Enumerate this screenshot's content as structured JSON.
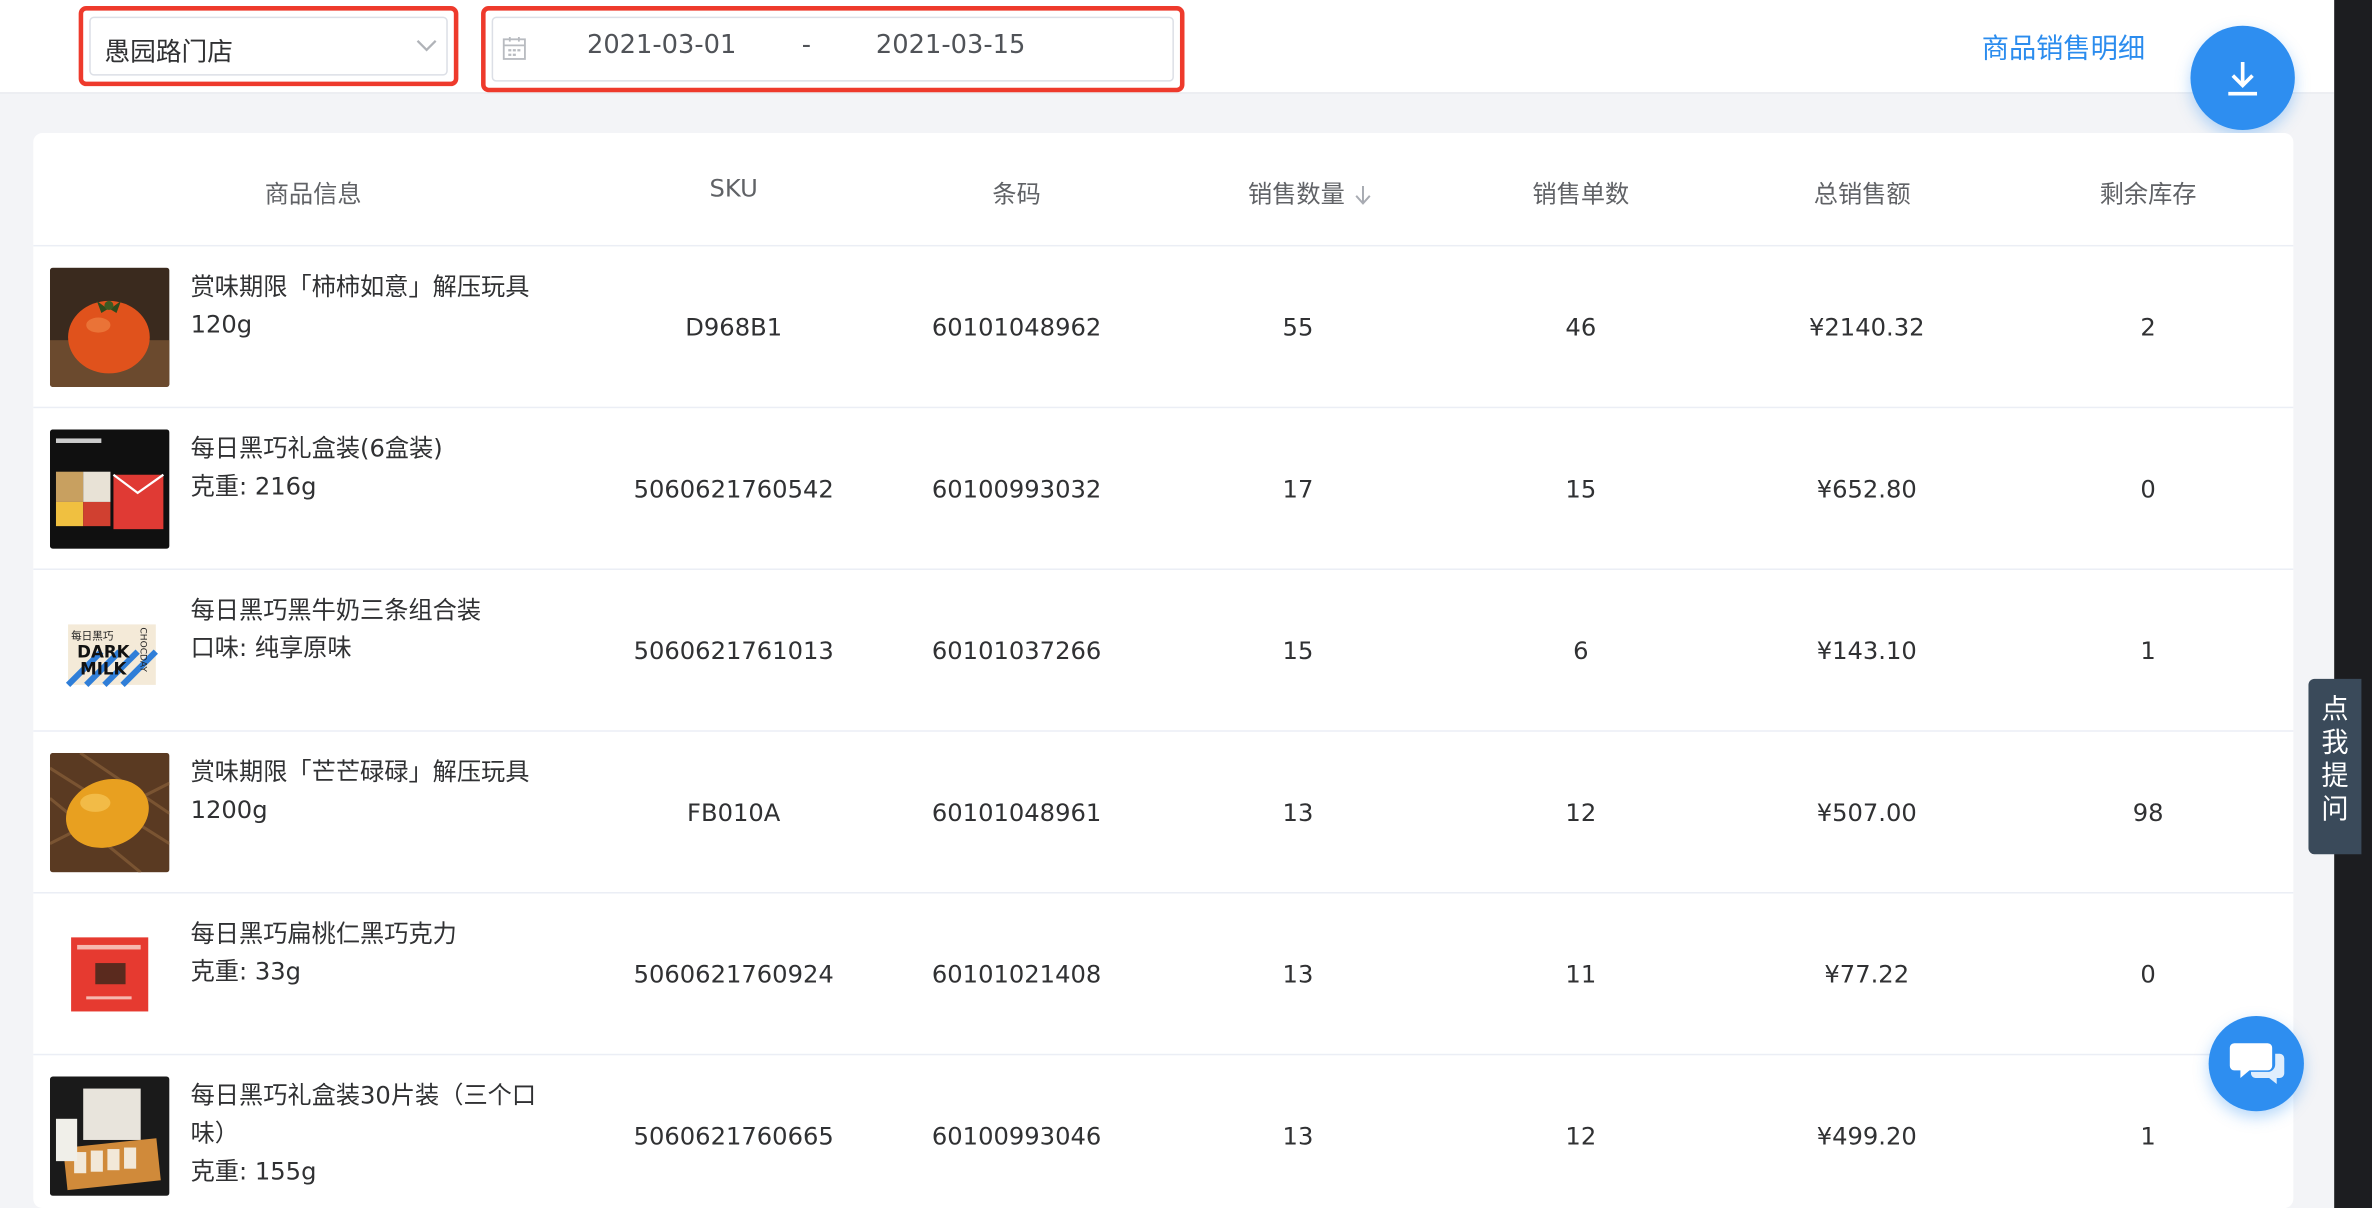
{
  "toolbar": {
    "store": "愚园路门店",
    "date_start": "2021-03-01",
    "date_sep": "-",
    "date_end": "2021-03-15",
    "detail_link": "商品销售明细"
  },
  "table": {
    "headers": {
      "product": "商品信息",
      "sku": "SKU",
      "barcode": "条码",
      "qty": "销售数量",
      "orders": "销售单数",
      "total": "总销售额",
      "stock": "剩余库存"
    },
    "sort": {
      "column": "qty",
      "direction": "desc"
    },
    "rows": [
      {
        "name": "赏味期限「柿柿如意」解压玩具",
        "spec": "120g",
        "sku": "D968B1",
        "barcode": "60101048962",
        "qty": "55",
        "orders": "46",
        "total": "¥2140.32",
        "stock": "2",
        "thumb": "persimmon"
      },
      {
        "name": "每日黑巧礼盒装(6盒装)",
        "spec": "克重: 216g",
        "sku": "5060621760542",
        "barcode": "60100993032",
        "qty": "17",
        "orders": "15",
        "total": "¥652.80",
        "stock": "0",
        "thumb": "giftbox"
      },
      {
        "name": "每日黑巧黑牛奶三条组合装",
        "spec": "口味: 纯享原味",
        "sku": "5060621761013",
        "barcode": "60101037266",
        "qty": "15",
        "orders": "6",
        "total": "¥143.10",
        "stock": "1",
        "thumb": "darkmilk"
      },
      {
        "name": "赏味期限「芒芒碌碌」解压玩具",
        "spec": "1200g",
        "sku": "FB010A",
        "barcode": "60101048961",
        "qty": "13",
        "orders": "12",
        "total": "¥507.00",
        "stock": "98",
        "thumb": "mango"
      },
      {
        "name": "每日黑巧扁桃仁黑巧克力",
        "spec": "克重: 33g",
        "sku": "5060621760924",
        "barcode": "60101021408",
        "qty": "13",
        "orders": "11",
        "total": "¥77.22",
        "stock": "0",
        "thumb": "redpack"
      },
      {
        "name": "每日黑巧礼盒装30片装（三个口味）",
        "spec": "克重: 155g",
        "sku": "5060621760665",
        "barcode": "60100993046",
        "qty": "13",
        "orders": "12",
        "total": "¥499.20",
        "stock": "1",
        "thumb": "box30"
      }
    ],
    "thumb_text": {
      "darkmilk_brand": "每日黑巧",
      "darkmilk_l1": "DARK",
      "darkmilk_l2": "MILK",
      "darkmilk_side": "CHOCDAY"
    }
  },
  "help_tab": [
    "点",
    "我",
    "提",
    "问"
  ],
  "icons": {
    "store_chevron": "chevron-down-icon",
    "calendar": "calendar-icon",
    "sort": "arrow-down-icon",
    "download": "download-icon",
    "chat": "chat-bubbles-icon"
  },
  "colors": {
    "accent": "#2e8ef0",
    "link": "#2b8cee",
    "highlight_border": "#ee3a2c",
    "help_tab_bg": "#3a4a5a"
  }
}
